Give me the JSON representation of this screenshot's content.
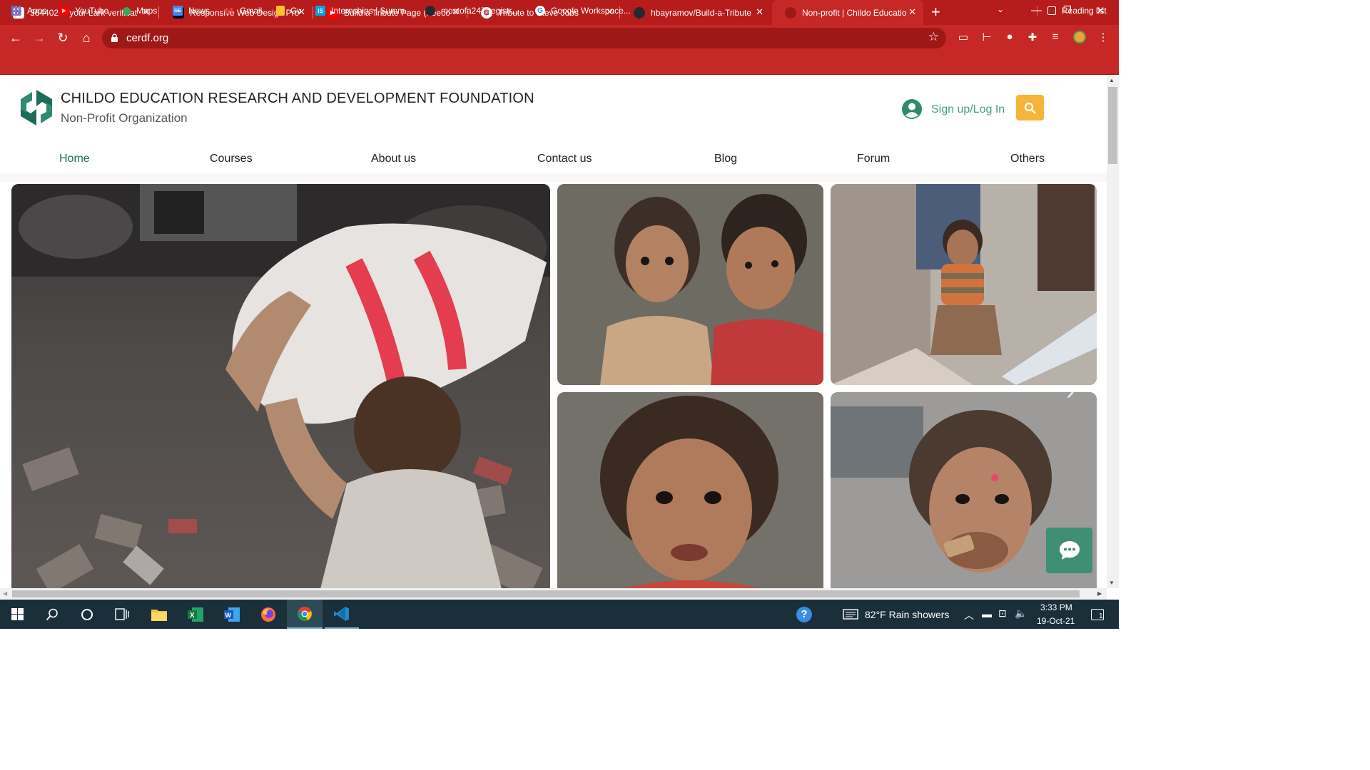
{
  "browser": {
    "tabs": [
      {
        "title": "364402 is your Lark verificat",
        "favicon": "gmail-icon",
        "fav_text": "M",
        "fav_color": "#ea4335",
        "active": false
      },
      {
        "title": "Responsive Web Design Pro",
        "favicon": "freecodecamp-icon",
        "fav_text": "(ʌ)",
        "fav_color": "#0a0a23",
        "active": false
      },
      {
        "title": "Build a Tribute Page (freeco",
        "favicon": "youtube-icon",
        "fav_text": "▶",
        "fav_color": "#ff0000",
        "active": false
      },
      {
        "title": "Tribute to Steve Jobs",
        "favicon": "globe-icon",
        "fav_text": "●",
        "fav_color": "#ffffff",
        "active": false
      },
      {
        "title": "hbayramov/Build-a-Tribute",
        "favicon": "github-icon",
        "fav_text": "●",
        "fav_color": "#24292e",
        "active": false
      },
      {
        "title": "Non-profit | Childo Educatio",
        "favicon": "site-icon",
        "fav_text": "◆",
        "fav_color": "#2e7d5b",
        "active": true
      }
    ],
    "url": "cerdf.org",
    "bookmarks": [
      {
        "label": "Apps",
        "icon": "apps-grid-icon",
        "fav_text": "⋮⋮",
        "fav_color": "#4285f4"
      },
      {
        "label": "YouTube",
        "icon": "youtube-icon",
        "fav_text": "▶",
        "fav_color": "#ff0000"
      },
      {
        "label": "Maps",
        "icon": "maps-pin-icon",
        "fav_text": "●",
        "fav_color": "#34a853"
      },
      {
        "label": "News",
        "icon": "news-icon",
        "fav_text": "GE",
        "fav_color": "#4285f4"
      },
      {
        "label": "Gmail",
        "icon": "gmail-icon",
        "fav_text": "M",
        "fav_color": "#ea4335"
      },
      {
        "label": "Gv",
        "icon": "folder-icon",
        "fav_text": "",
        "fav_color": "#fbc02d"
      },
      {
        "label": "Internships | Summ...",
        "icon": "internshala-icon",
        "fav_text": "IS",
        "fav_color": "#00a5ec"
      },
      {
        "label": "mostofa247/registr...",
        "icon": "github-icon",
        "fav_text": "●",
        "fav_color": "#24292e"
      },
      {
        "label": "Google Workspace...",
        "icon": "google-icon",
        "fav_text": "G",
        "fav_color": "#ffffff"
      }
    ],
    "reading_list": "Reading list"
  },
  "site": {
    "org_name": "CHILDO EDUCATION RESEARCH AND DEVELOPMENT FOUNDATION",
    "org_subtitle": "Non-Profit Organization",
    "signup_label": "Sign up/Log In",
    "nav": [
      {
        "label": "Home",
        "active": true
      },
      {
        "label": "Courses",
        "active": false
      },
      {
        "label": "About us",
        "active": false
      },
      {
        "label": "Contact us",
        "active": false
      },
      {
        "label": "Blog",
        "active": false
      },
      {
        "label": "Forum",
        "active": false
      },
      {
        "label": "Others",
        "active": false
      }
    ],
    "colors": {
      "brand_green": "#1f6b5a",
      "accent_orange": "#f6b53a",
      "chat_green": "#3e8f73",
      "browser_red": "#c62828"
    }
  },
  "taskbar": {
    "weather": "82°F  Rain showers",
    "time": "3:33 PM",
    "date": "19-Oct-21",
    "notifications": "1"
  }
}
